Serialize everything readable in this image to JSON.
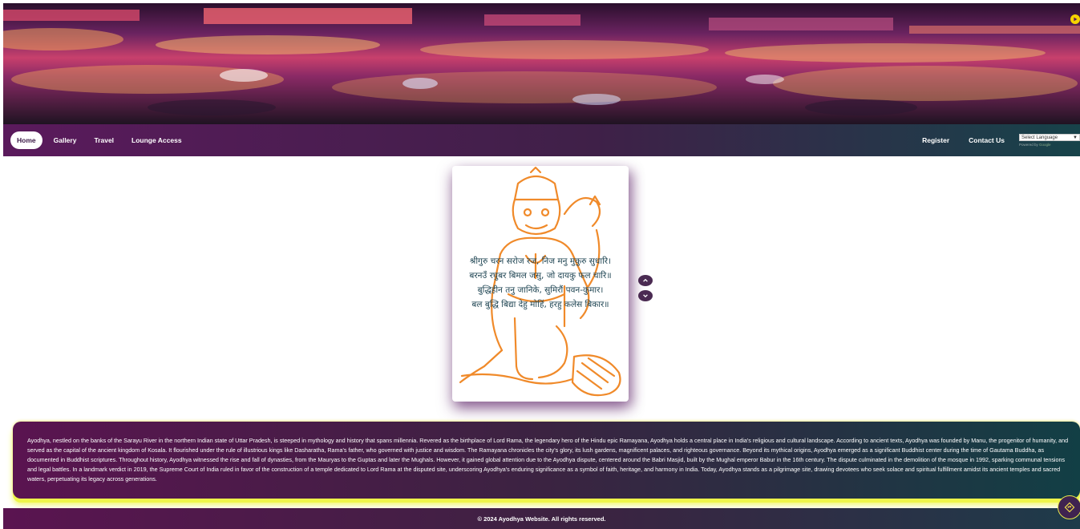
{
  "header": {
    "banner_alt": "Ayodhya deepotsav banner",
    "play_icon": "play-icon"
  },
  "nav": {
    "left": [
      {
        "label": "Home",
        "active": true
      },
      {
        "label": "Gallery",
        "active": false
      },
      {
        "label": "Travel",
        "active": false
      },
      {
        "label": "Lounge Access",
        "active": false
      }
    ],
    "right": [
      {
        "label": "Register"
      },
      {
        "label": "Contact Us"
      }
    ],
    "language_select": {
      "selected": "Select Language",
      "powered_by": "Powered by",
      "powered_brand": "Google"
    }
  },
  "card": {
    "verse": [
      "श्रीगुरु चरन सरोज रज, निज मनु मुकुरु सुधारि।",
      "बरनउँ रघुबर बिमल जसु, जो दायकु फल चारि॥",
      "बुद्धिहीन तनु जानिके, सुमिरौं पवन-कुमार।",
      "बल बुद्धि बिद्या देहु मोहिं, हरहु कलेस बिकार॥"
    ],
    "prev_icon": "chevron-up-icon",
    "next_icon": "chevron-down-icon"
  },
  "info": {
    "text": "Ayodhya, nestled on the banks of the Sarayu River in the northern Indian state of Uttar Pradesh, is steeped in mythology and history that spans millennia. Revered as the birthplace of Lord Rama, the legendary hero of the Hindu epic Ramayana, Ayodhya holds a central place in India's religious and cultural landscape. According to ancient texts, Ayodhya was founded by Manu, the progenitor of humanity, and served as the capital of the ancient kingdom of Kosala. It flourished under the rule of illustrious kings like Dasharatha, Rama's father, who governed with justice and wisdom. The Ramayana chronicles the city's glory, its lush gardens, magnificent palaces, and righteous governance. Beyond its mythical origins, Ayodhya emerged as a significant Buddhist center during the time of Gautama Buddha, as documented in Buddhist scriptures. Throughout history, Ayodhya witnessed the rise and fall of dynasties, from the Mauryas to the Guptas and later the Mughals. However, it gained global attention due to the Ayodhya dispute, centered around the Babri Masjid, built by the Mughal emperor Babur in the 16th century. The dispute culminated in the demolition of the mosque in 1992, sparking communal tensions and legal battles. In a landmark verdict in 2019, the Supreme Court of India ruled in favor of the construction of a temple dedicated to Lord Rama at the disputed site, underscoring Ayodhya's enduring significance as a symbol of faith, heritage, and harmony in India. Today, Ayodhya stands as a pilgrimage site, drawing devotees who seek solace and spiritual fulfillment amidst its ancient temples and sacred waters, perpetuating its legacy across generations."
  },
  "footer": {
    "copyright": "© 2024 Ayodhya Website. All rights reserved."
  },
  "colors": {
    "nav_start": "#5a1a5c",
    "nav_end": "#17434a",
    "figure_orange": "#f08a2a",
    "verse_text": "#1f4553",
    "glow_yellow": "#eef54a"
  }
}
